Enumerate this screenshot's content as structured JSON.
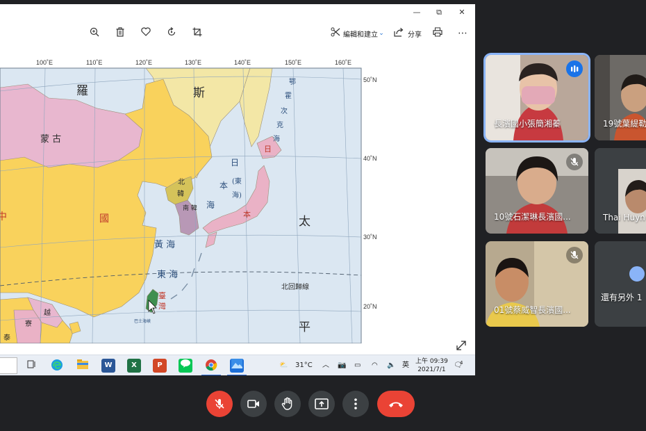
{
  "window": {
    "minimize_glyph": "—",
    "restore_glyph": "⧉",
    "close_glyph": "✕"
  },
  "toolbar": {
    "edit_create_label": "編輯和建立",
    "share_label": "分享"
  },
  "map": {
    "lon_labels": [
      "100˚E",
      "110˚E",
      "120˚E",
      "130˚E",
      "140˚E",
      "150˚E",
      "160˚E"
    ],
    "lat_labels": [
      "50˚N",
      "40˚N",
      "30˚N",
      "20˚N"
    ],
    "region_labels": {
      "luo": "羅",
      "si": "斯",
      "mongolia": "蒙  古",
      "china_guo": "國",
      "china_zhong": "中",
      "north_korea_1": "北",
      "north_korea_2": "韓",
      "south_korea": "南\n韓",
      "japan_ri": "日",
      "japan_ben": "本",
      "taiwan_1": "臺",
      "taiwan_2": "灣",
      "vietnam": "越",
      "laos": "寮",
      "thailand": "泰",
      "pacific_tai": "太",
      "pacific_ping": "平"
    },
    "sea_labels": {
      "sea_of_japan_ri": "日",
      "sea_of_japan_ben": "本",
      "sea_of_japan_east": "(東",
      "sea_of_japan_hai": "海)",
      "yellow_sea": "黃 海",
      "east_china_sea": "東 海",
      "okhotsk_1": "鄂",
      "okhotsk_2": "霍",
      "okhotsk_3": "次",
      "okhotsk_4": "克",
      "okhotsk_5": "海",
      "bashi": "巴士海峽",
      "korea_sea": "海"
    },
    "tropic_label": "北回歸線"
  },
  "taskbar": {
    "weather": "31°C",
    "ime": "英",
    "time": "上午 09:39",
    "date": "2021/7/1",
    "notifications": "4"
  },
  "participants": [
    {
      "name": "長濱國小張簡湘蓁",
      "state": "speaking"
    },
    {
      "name": "19號葉緹勒",
      "state": "normal"
    },
    {
      "name": "10號石潔琳長濱國...",
      "state": "muted"
    },
    {
      "name": "Thai Huyn",
      "state": "normal"
    },
    {
      "name": "01號蔡威智長濱國...",
      "state": "muted"
    },
    {
      "name": "還有另外 1",
      "state": "more"
    }
  ],
  "colors": {
    "mic_off": "#ea4335",
    "end_call": "#ea4335",
    "speaking_ring": "#8ab4f8",
    "china": "#f9d25c",
    "mongolia": "#e8b7cf",
    "russia": "#f3e7a6",
    "sea": "#dbe7f2",
    "japan": "#eab2c6",
    "korea_north": "#d5c35a",
    "korea_south": "#b898b6",
    "taiwan": "#3f8f4f"
  }
}
